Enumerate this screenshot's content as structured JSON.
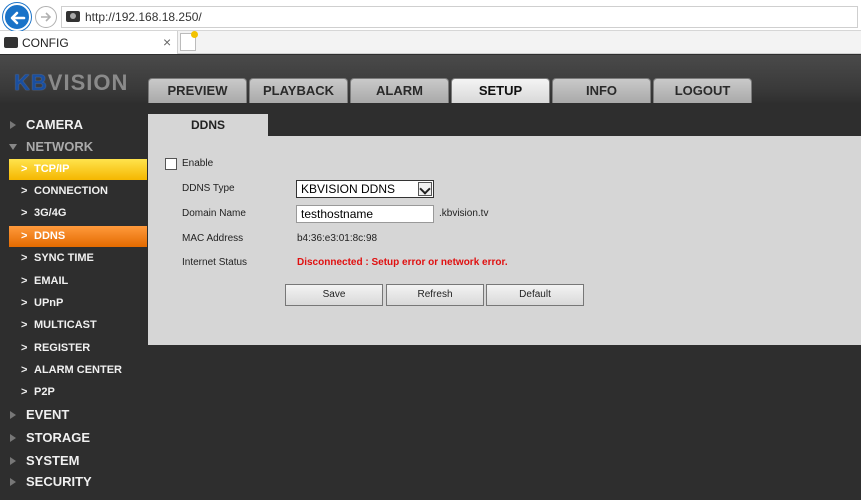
{
  "browser": {
    "url": "http://192.168.18.250/",
    "tab_title": "CONFIG",
    "tab_close": "×"
  },
  "brand": {
    "logo_part1": "KB",
    "logo_part2": "VISION"
  },
  "nav": {
    "tabs": [
      {
        "label": "PREVIEW",
        "active": false
      },
      {
        "label": "PLAYBACK",
        "active": false
      },
      {
        "label": "ALARM",
        "active": false
      },
      {
        "label": "SETUP",
        "active": true
      },
      {
        "label": "INFO",
        "active": false
      },
      {
        "label": "LOGOUT",
        "active": false
      }
    ]
  },
  "sidebar": {
    "camera": "CAMERA",
    "network": "NETWORK",
    "network_items": [
      "TCP/IP",
      "CONNECTION",
      "3G/4G",
      "DDNS",
      "SYNC TIME",
      "EMAIL",
      "UPnP",
      "MULTICAST",
      "REGISTER",
      "ALARM CENTER",
      "P2P"
    ],
    "event": "EVENT",
    "storage": "STORAGE",
    "system": "SYSTEM",
    "security": "SECURITY",
    "chevron": ">"
  },
  "ddns": {
    "tab": "DDNS",
    "enable_label": "Enable",
    "enabled": false,
    "type_label": "DDNS Type",
    "type_value": "KBVISION DDNS",
    "domain_label": "Domain Name",
    "domain_value": "testhostname",
    "domain_suffix": ".kbvision.tv",
    "mac_label": "MAC Address",
    "mac_value": "b4:36:e3:01:8c:98",
    "status_label": "Internet Status",
    "status_value": "Disconnected : Setup error or network error.",
    "status_color": "#e01010"
  },
  "buttons": {
    "save": "Save",
    "refresh": "Refresh",
    "default": "Default"
  },
  "colors": {
    "highlight_yellow": "#f5b700",
    "highlight_orange": "#e36a00",
    "brand_blue": "#1a4fa0"
  }
}
